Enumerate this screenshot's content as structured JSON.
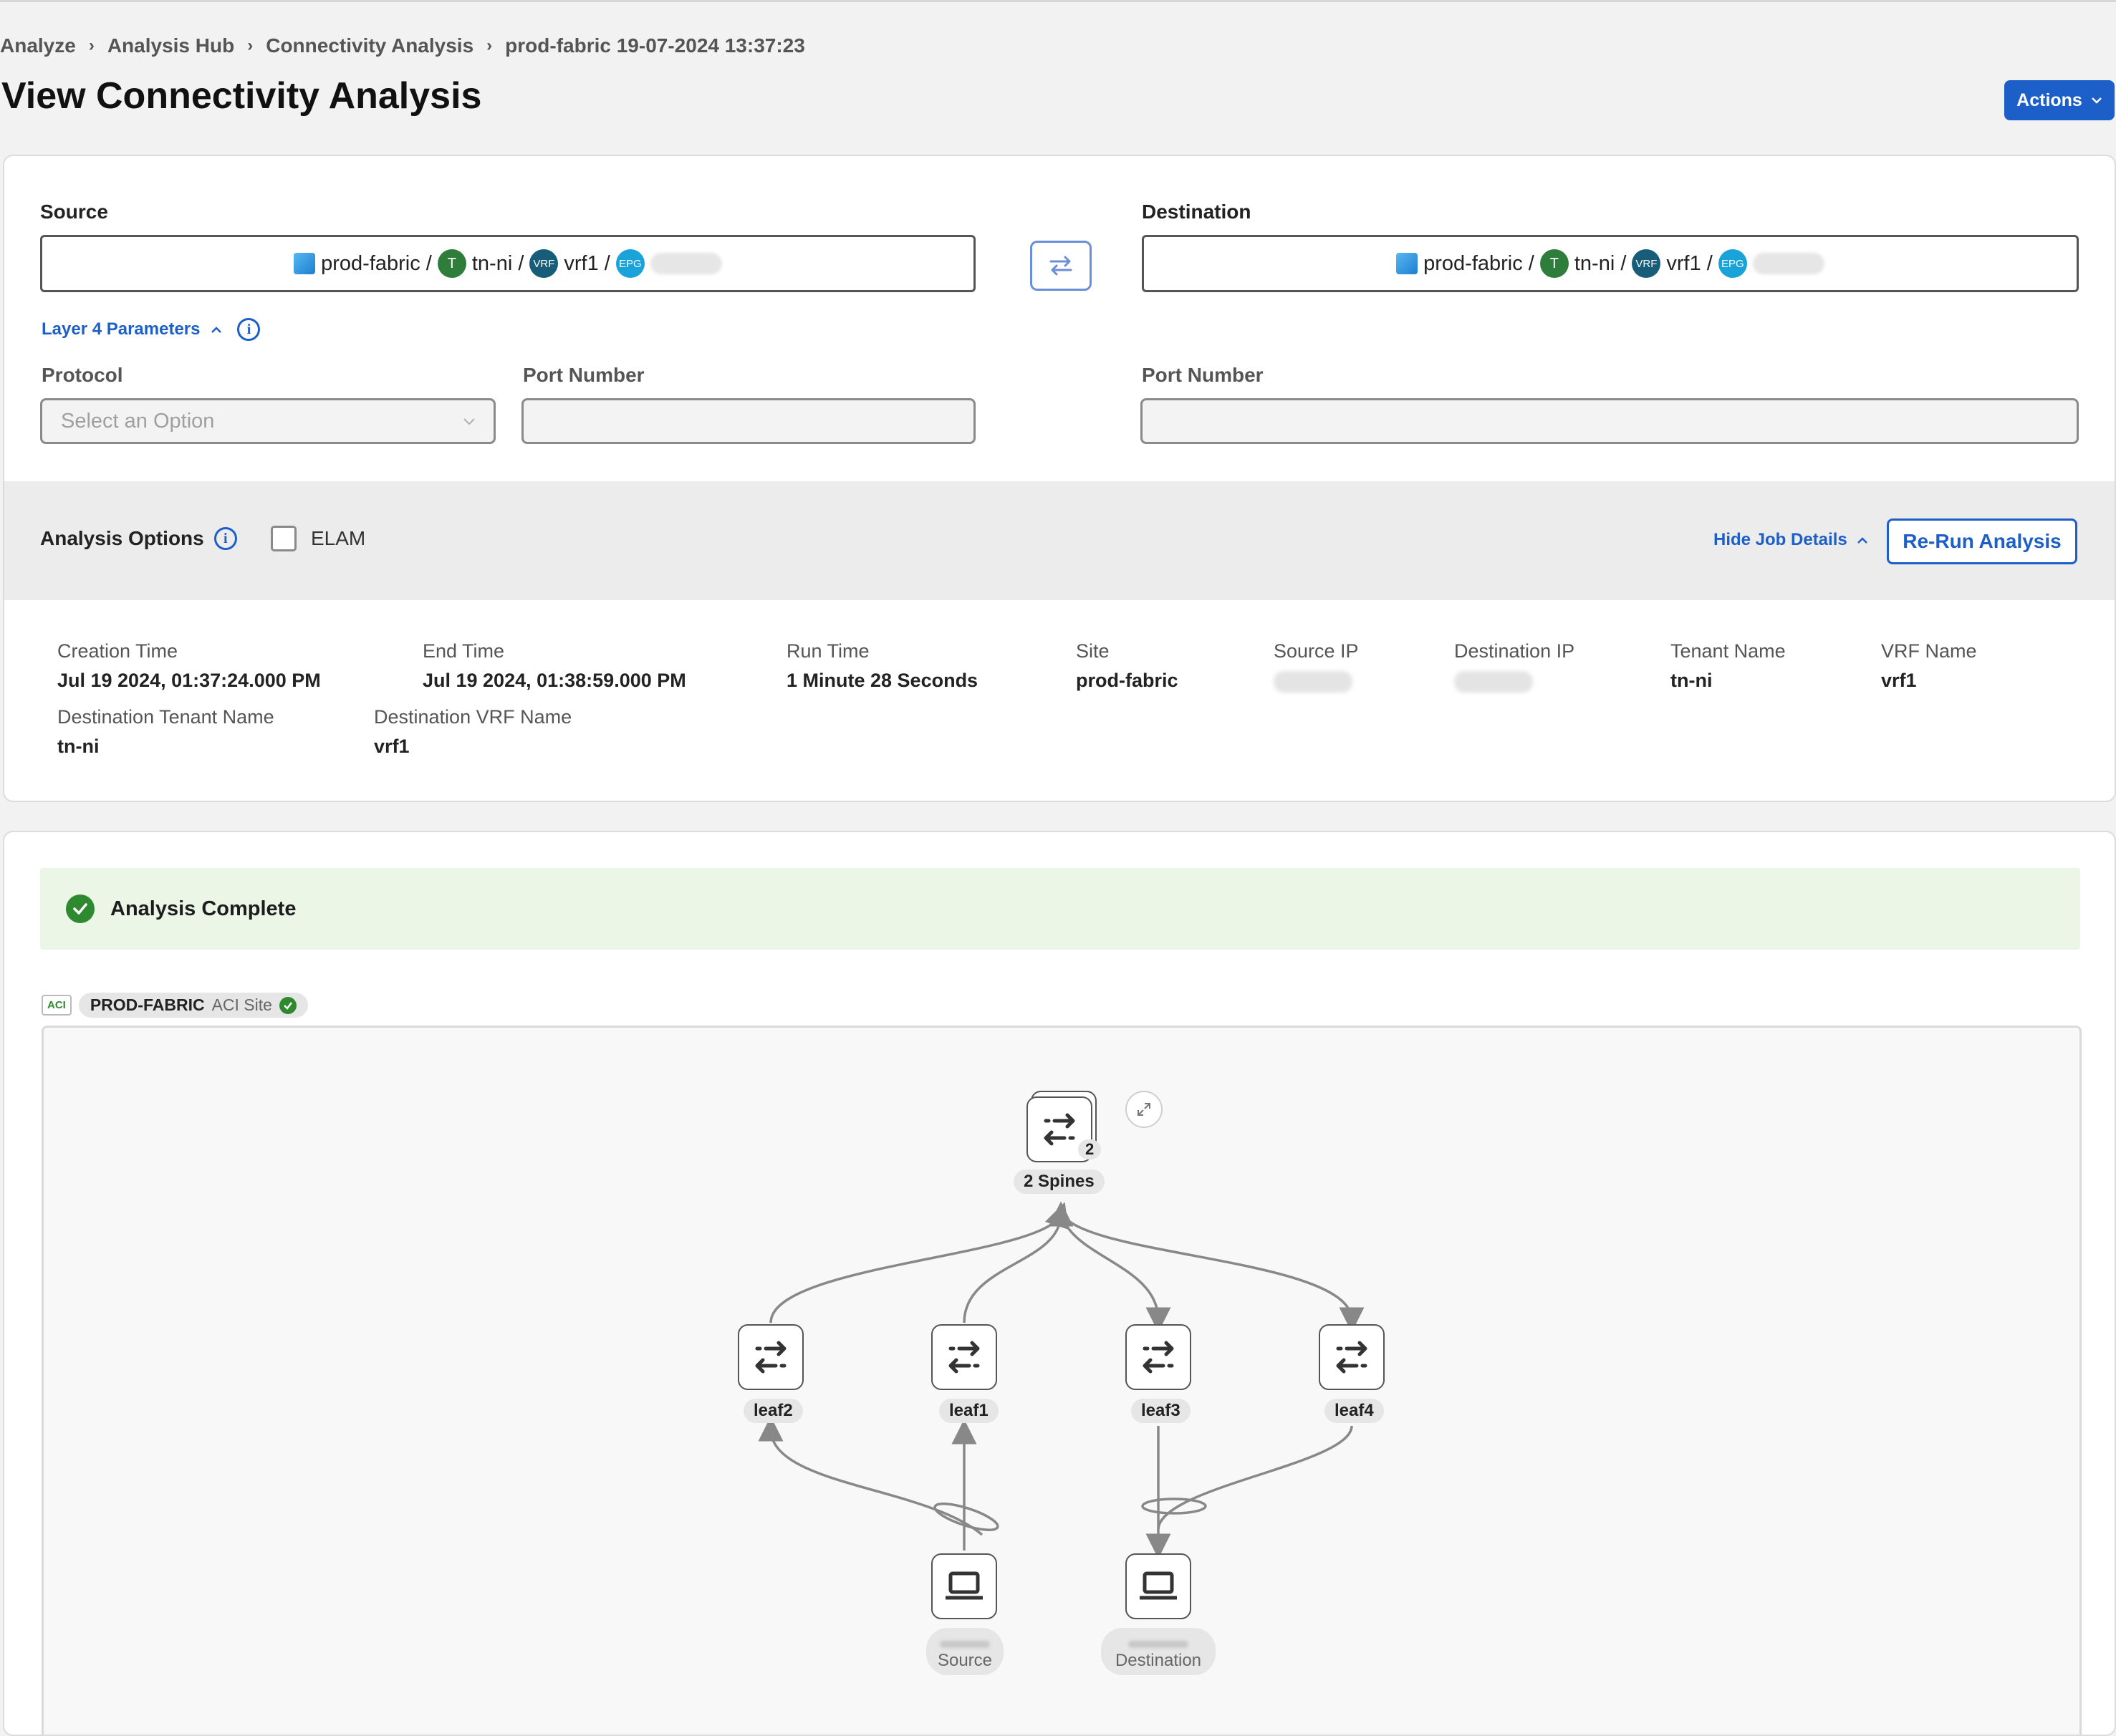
{
  "breadcrumb": [
    "Analyze",
    "Analysis Hub",
    "Connectivity Analysis",
    "prod-fabric 19-07-2024 13:37:23"
  ],
  "breadcrumb_separator": "›",
  "page_title": "View Connectivity Analysis",
  "actions_label": "Actions",
  "source": {
    "label": "Source",
    "fabric": "prod-fabric /",
    "tenant_badge": "T",
    "tenant": "tn-ni /",
    "vrf_badge": "VRF",
    "vrf": "vrf1 /",
    "epg_badge": "EPG"
  },
  "destination": {
    "label": "Destination",
    "fabric": "prod-fabric /",
    "tenant_badge": "T",
    "tenant": "tn-ni /",
    "vrf_badge": "VRF",
    "vrf": "vrf1 /",
    "epg_badge": "EPG"
  },
  "layer4": {
    "toggle_label": "Layer 4 Parameters",
    "protocol_label": "Protocol",
    "protocol_placeholder": "Select an Option",
    "src_port_label": "Port Number",
    "dst_port_label": "Port Number"
  },
  "analysis_options": {
    "label": "Analysis Options",
    "elam_label": "ELAM",
    "hide_job_details": "Hide Job Details",
    "rerun_label": "Re-Run Analysis"
  },
  "job_details": [
    {
      "label": "Creation Time",
      "value": "Jul 19 2024, 01:37:24.000 PM"
    },
    {
      "label": "End Time",
      "value": "Jul 19 2024, 01:38:59.000 PM"
    },
    {
      "label": "Run Time",
      "value": "1 Minute 28 Seconds"
    },
    {
      "label": "Site",
      "value": "prod-fabric"
    },
    {
      "label": "Source IP",
      "value": null
    },
    {
      "label": "Destination IP",
      "value": null
    },
    {
      "label": "Tenant Name",
      "value": "tn-ni"
    },
    {
      "label": "VRF Name",
      "value": "vrf1"
    },
    {
      "label": "Destination Tenant Name",
      "value": "tn-ni"
    },
    {
      "label": "Destination VRF Name",
      "value": "vrf1"
    }
  ],
  "result": {
    "status": "Analysis Complete"
  },
  "site": {
    "tag": "ACI",
    "name": "PROD-FABRIC",
    "type": "ACI Site"
  },
  "topology": {
    "spines": {
      "label": "2 Spines",
      "count": "2"
    },
    "leaves": [
      "leaf2",
      "leaf1",
      "leaf3",
      "leaf4"
    ],
    "source_label": "Source",
    "destination_label": "Destination"
  },
  "colors": {
    "accent": "#1c5fc9",
    "success": "#2f8a2f",
    "success_bg": "#ebf6e6"
  }
}
